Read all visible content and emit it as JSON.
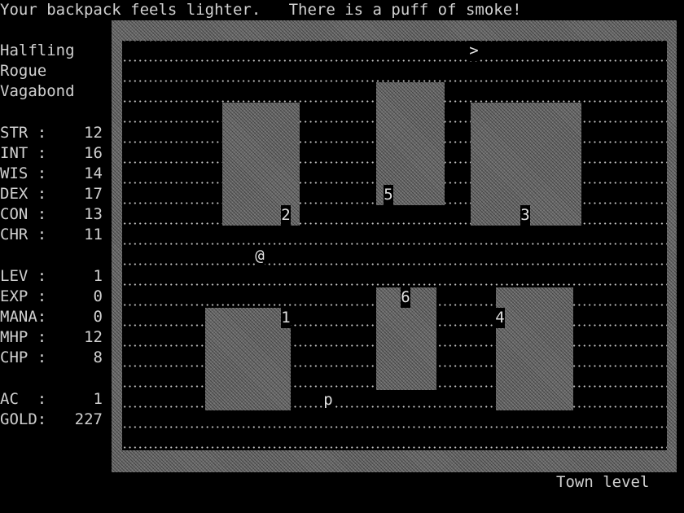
{
  "message": "Your backpack feels lighter.   There is a puff of smoke!",
  "character": {
    "race": "Halfling",
    "class": "Rogue",
    "title": "Vagabond"
  },
  "stats": [
    {
      "label": "STR :",
      "value": "12"
    },
    {
      "label": "INT :",
      "value": "16"
    },
    {
      "label": "WIS :",
      "value": "14"
    },
    {
      "label": "DEX :",
      "value": "17"
    },
    {
      "label": "CON :",
      "value": "13"
    },
    {
      "label": "CHR :",
      "value": "11"
    }
  ],
  "level_info": [
    {
      "label": "LEV :",
      "value": "1"
    },
    {
      "label": "EXP :",
      "value": "0"
    },
    {
      "label": "MANA:",
      "value": "0"
    },
    {
      "label": "MHP :",
      "value": "12"
    },
    {
      "label": "CHP :",
      "value": "8"
    }
  ],
  "armor": [
    {
      "label": "AC  :",
      "value": "1"
    },
    {
      "label": "GOLD:",
      "value": "227"
    }
  ],
  "map": {
    "stairs_glyph": ">",
    "player_glyph": "@",
    "monster_glyph": "p",
    "shop_numbers": [
      "1",
      "2",
      "3",
      "4",
      "5",
      "6"
    ]
  },
  "status": {
    "depth": "Town level"
  }
}
